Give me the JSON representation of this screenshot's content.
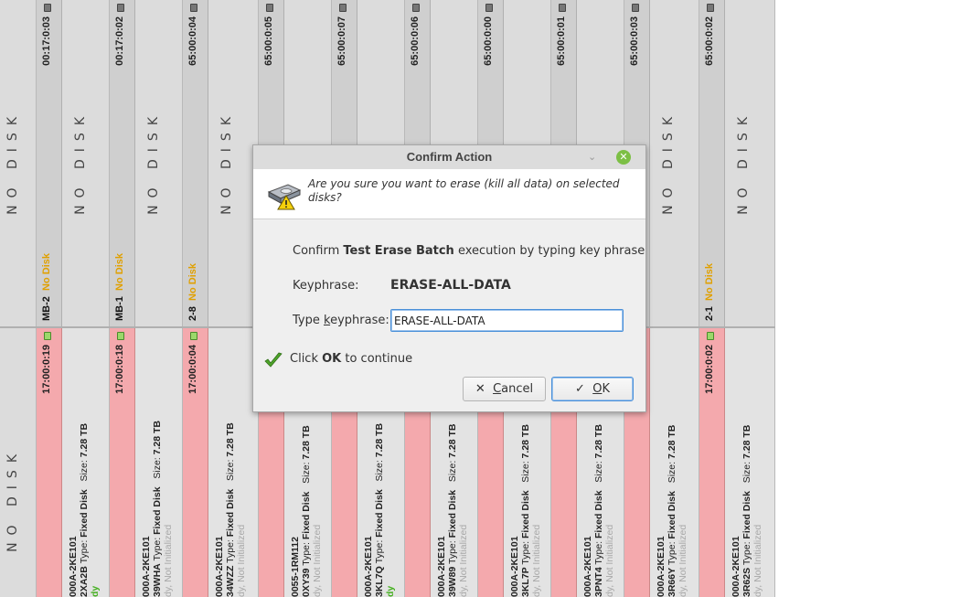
{
  "background_tiles": {
    "top": [
      {
        "timer": "",
        "label": "NO DISK",
        "slot": "",
        "status": ""
      },
      {
        "timer": "00:17:0:03",
        "label": "NO DISK",
        "slot": "MB-2",
        "status": "No Disk"
      },
      {
        "timer": "00:17:0:02",
        "label": "NO DISK",
        "slot": "MB-1",
        "status": "No Disk"
      },
      {
        "timer": "65:00:0:04",
        "label": "NO DISK",
        "slot": "2-8",
        "status": "No Disk"
      },
      {
        "timer": "65:00:0:05",
        "label": "",
        "slot": "",
        "status": ""
      },
      {
        "timer": "65:00:0:07",
        "label": "",
        "slot": "",
        "status": ""
      },
      {
        "timer": "65:00:0:06",
        "label": "",
        "slot": "",
        "status": ""
      },
      {
        "timer": "65:00:0:00",
        "label": "",
        "slot": "",
        "status": ""
      },
      {
        "timer": "65:00:0:01",
        "label": "",
        "slot": "",
        "status": ""
      },
      {
        "timer": "65:00:0:03",
        "label": "NO DISK",
        "slot": "",
        "status": ""
      },
      {
        "timer": "65:00:0:02",
        "label": "NO DISK",
        "slot": "2-1",
        "status": "No Disk"
      }
    ],
    "bottom": [
      {
        "timer": "",
        "label": "NO DISK"
      },
      {
        "timer": "17:00:0:19",
        "model": "000A-2KE101",
        "serial": "2XA2B",
        "type": "Fixed Disk",
        "size": "7.28 TB",
        "state": "dy",
        "state_color": "green"
      },
      {
        "timer": "17:00:0:18",
        "model": "000A-2KE101",
        "serial": "39WHA",
        "type": "Fixed Disk",
        "size": "7.28 TB",
        "state": "dy, Not Initialized",
        "state_color": "gray"
      },
      {
        "timer": "17:00:0:04",
        "model": "000A-2KE101",
        "serial": "34WZZ",
        "type": "Fixed Disk",
        "size": "7.28 TB",
        "state": "dy, Not Initialized",
        "state_color": "gray"
      },
      {
        "timer": "",
        "model": "0055-1RM112",
        "serial": "0XY39",
        "type": "Fixed Disk",
        "size": "7.28 TB",
        "state": "dy, Not Initialized",
        "state_color": "gray"
      },
      {
        "timer": "",
        "model": "000A-2KE101",
        "serial": "3KL7Q",
        "type": "Fixed Disk",
        "size": "7.28 TB",
        "state": "dy",
        "state_color": "green"
      },
      {
        "timer": "",
        "model": "000A-2KE101",
        "serial": "39W89",
        "type": "Fixed Disk",
        "size": "7.28 TB",
        "state": "dy, Not Initialized",
        "state_color": "gray"
      },
      {
        "timer": "",
        "model": "000A-2KE101",
        "serial": "3KL7P",
        "type": "Fixed Disk",
        "size": "7.28 TB",
        "state": "dy, Not Initialized",
        "state_color": "gray"
      },
      {
        "timer": "",
        "model": "000A-2KE101",
        "serial": "3PNT4",
        "type": "Fixed Disk",
        "size": "7.28 TB",
        "state": "dy, Not Initialized",
        "state_color": "gray"
      },
      {
        "timer": "",
        "model": "000A-2KE101",
        "serial": "3R66Y",
        "type": "Fixed Disk",
        "size": "7.28 TB",
        "state": "dy, Not Initialized",
        "state_color": "gray"
      },
      {
        "timer": "17:00:0:02",
        "model": "000A-2KE101",
        "serial": "3R62S",
        "type": "Fixed Disk",
        "size": "7.28 TB",
        "state": "dy, Not Initialized",
        "state_color": "gray"
      }
    ]
  },
  "dialog": {
    "title": "Confirm Action",
    "question": "Are you sure you want to erase (kill all data) on selected disks?",
    "instruction_prefix": "Confirm ",
    "instruction_bold": "Test Erase Batch",
    "instruction_suffix": " execution by typing key phrase",
    "keyphrase_label": "Keyphrase:",
    "keyphrase_value": "ERASE-ALL-DATA",
    "type_label_pre": "Type ",
    "type_label_ul": "k",
    "type_label_post": "eyphrase:",
    "input_value": "ERASE-ALL-DATA",
    "continue_pre": "Click ",
    "continue_bold": "OK",
    "continue_post": " to continue",
    "cancel_symbol": "✕",
    "cancel_ul": "C",
    "cancel_rest": "ancel",
    "ok_symbol": "✓",
    "ok_ul": "O",
    "ok_rest": "K",
    "close_glyph": "✕",
    "minimize_glyph": "⌄"
  },
  "colors": {
    "accent": "#4a90d9",
    "failed_strip": "#f4a9ad",
    "status_orange": "#e0a000",
    "ready_green": "#45b020"
  }
}
